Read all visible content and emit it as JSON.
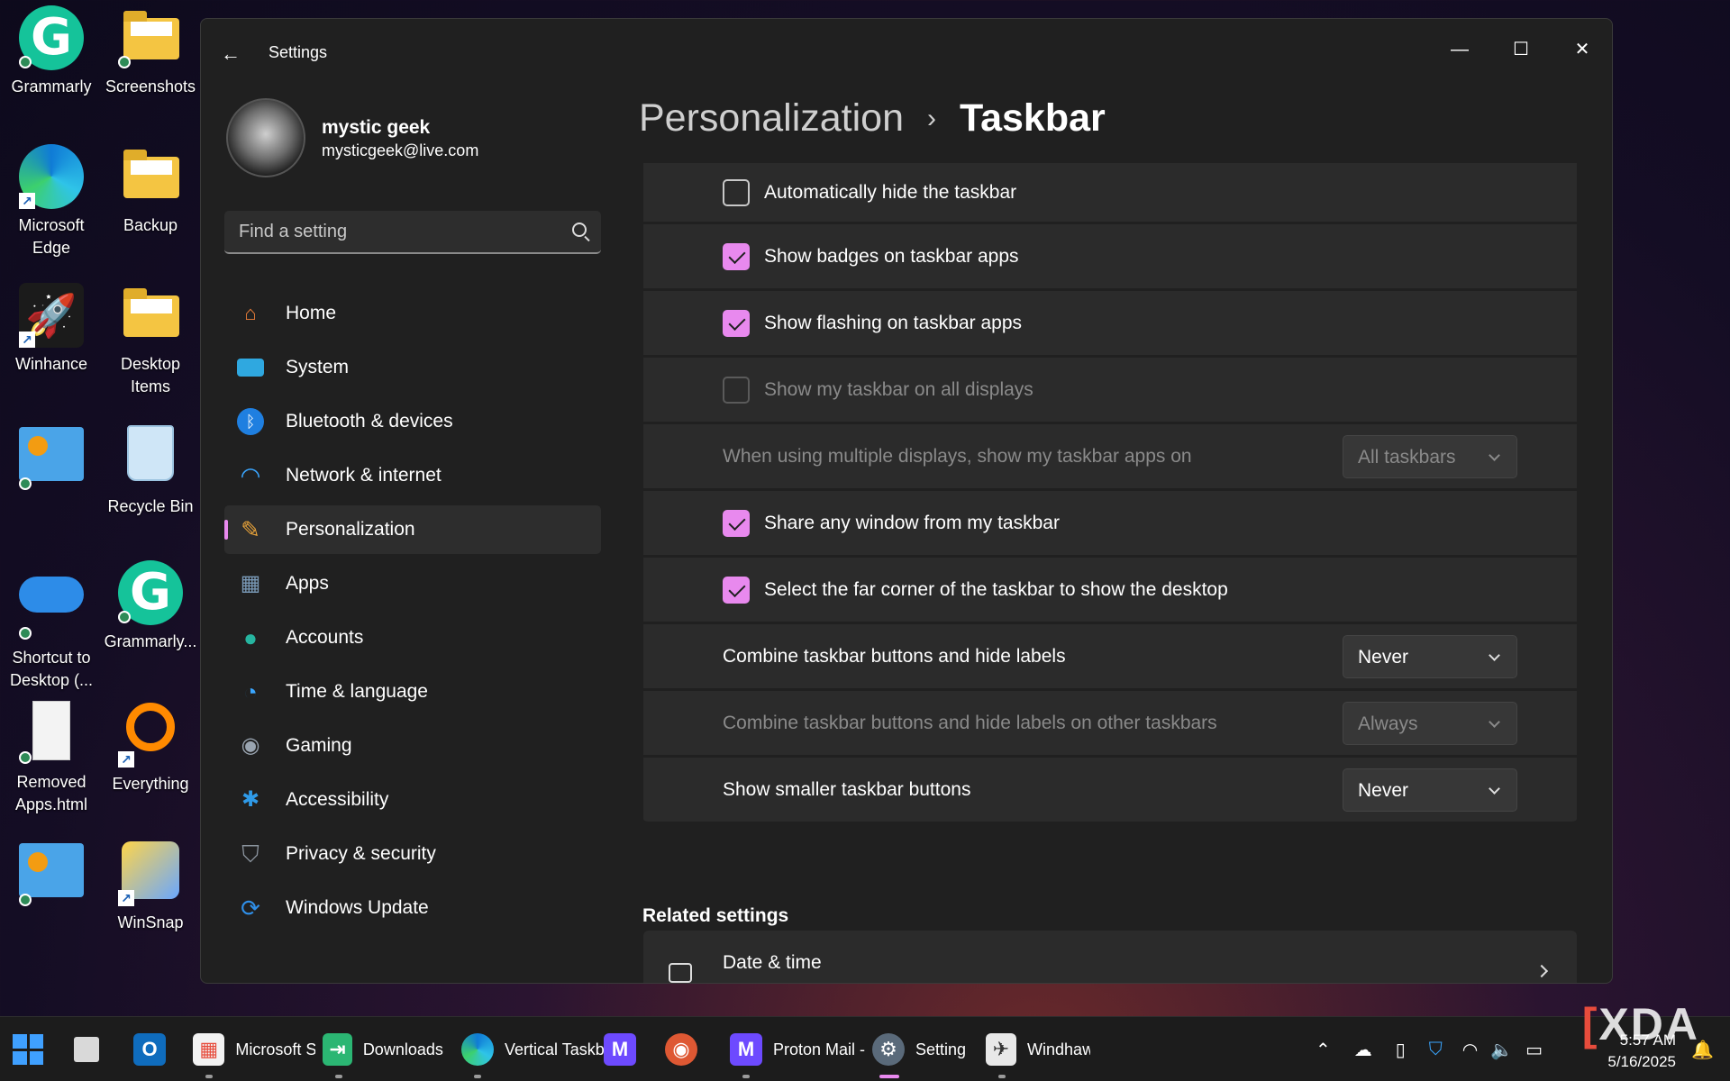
{
  "desktop": {
    "icons": [
      {
        "label": "Grammarly",
        "icon": "grammarly-icon"
      },
      {
        "label": "Screenshots",
        "icon": "folder-icon"
      },
      {
        "label": "Microsoft Edge",
        "icon": "edge-icon"
      },
      {
        "label": "Backup",
        "icon": "folder-icon"
      },
      {
        "label": "Winhance",
        "icon": "rocket-icon"
      },
      {
        "label": "Desktop Items",
        "icon": "folder-icon"
      },
      {
        "label": "",
        "icon": "app-tile-icon"
      },
      {
        "label": "Recycle Bin",
        "icon": "recycle-bin-icon"
      },
      {
        "label": "Shortcut to Desktop (...",
        "icon": "onedrive-icon"
      },
      {
        "label": "Grammarly...",
        "icon": "grammarly-icon"
      },
      {
        "label": "Removed Apps.html",
        "icon": "document-icon"
      },
      {
        "label": "Everything",
        "icon": "everything-icon"
      },
      {
        "label": "",
        "icon": "app-tile-icon"
      },
      {
        "label": "WinSnap",
        "icon": "winsnap-icon"
      }
    ]
  },
  "window": {
    "title": "Settings",
    "controls": {
      "minimize": "—",
      "maximize": "☐",
      "close": "✕"
    }
  },
  "profile": {
    "name": "mystic geek",
    "email": "mysticgeek@live.com"
  },
  "search": {
    "placeholder": "Find a setting"
  },
  "nav": {
    "items": [
      {
        "label": "Home",
        "icon": "home-icon",
        "color": "#f0813a"
      },
      {
        "label": "System",
        "icon": "monitor-icon",
        "color": "#2fa8e0"
      },
      {
        "label": "Bluetooth & devices",
        "icon": "bluetooth-icon",
        "color": "#1f7fe0"
      },
      {
        "label": "Network & internet",
        "icon": "wifi-icon",
        "color": "#3aa6ff"
      },
      {
        "label": "Personalization",
        "icon": "brush-icon",
        "color": "#e8a33a"
      },
      {
        "label": "Apps",
        "icon": "apps-icon",
        "color": "#7a9ab8"
      },
      {
        "label": "Accounts",
        "icon": "person-icon",
        "color": "#26b5a0"
      },
      {
        "label": "Time & language",
        "icon": "globe-clock-icon",
        "color": "#3aa6ff"
      },
      {
        "label": "Gaming",
        "icon": "gamepad-icon",
        "color": "#9aa5b1"
      },
      {
        "label": "Accessibility",
        "icon": "accessibility-icon",
        "color": "#2f9ae8"
      },
      {
        "label": "Privacy & security",
        "icon": "shield-icon",
        "color": "#8d96a0"
      },
      {
        "label": "Windows Update",
        "icon": "update-icon",
        "color": "#2f8fe8"
      }
    ],
    "selected": "Personalization"
  },
  "breadcrumb": {
    "parent": "Personalization",
    "separator": "›",
    "current": "Taskbar"
  },
  "settings": {
    "auto_hide": {
      "label": "Automatically hide the taskbar",
      "checked": false
    },
    "badges": {
      "label": "Show badges on taskbar apps",
      "checked": true
    },
    "flashing": {
      "label": "Show flashing on taskbar apps",
      "checked": true
    },
    "all_displays": {
      "label": "Show my taskbar on all displays",
      "checked": false,
      "disabled": true
    },
    "multi_display_apps": {
      "label": "When using multiple displays, show my taskbar apps on",
      "value": "All taskbars",
      "disabled": true
    },
    "share_window": {
      "label": "Share any window from my taskbar",
      "checked": true
    },
    "far_corner": {
      "label": "Select the far corner of the taskbar to show the desktop",
      "checked": true
    },
    "combine_buttons": {
      "label": "Combine taskbar buttons and hide labels",
      "value": "Never"
    },
    "combine_other": {
      "label": "Combine taskbar buttons and hide labels on other taskbars",
      "value": "Always",
      "disabled": true
    },
    "smaller_buttons": {
      "label": "Show smaller taskbar buttons",
      "value": "Never"
    }
  },
  "related": {
    "title": "Related settings",
    "items": [
      {
        "label": "Date & time"
      }
    ]
  },
  "taskbar": {
    "apps": [
      {
        "label": "Microsoft S",
        "icon": "microsoft-store-icon"
      },
      {
        "label": "Downloads -",
        "icon": "file-explorer-icon"
      },
      {
        "label": "Vertical Taskb",
        "icon": "edge-icon"
      },
      {
        "label": "Proton Mail -",
        "icon": "proton-mail-icon"
      },
      {
        "label": "Setting",
        "icon": "settings-icon"
      },
      {
        "label": "Windhaw",
        "icon": "windhawk-icon"
      }
    ],
    "clock": {
      "time": "5:57 AM",
      "date": "5/16/2025"
    },
    "accent": "#e889ee"
  },
  "watermark": "XDA"
}
